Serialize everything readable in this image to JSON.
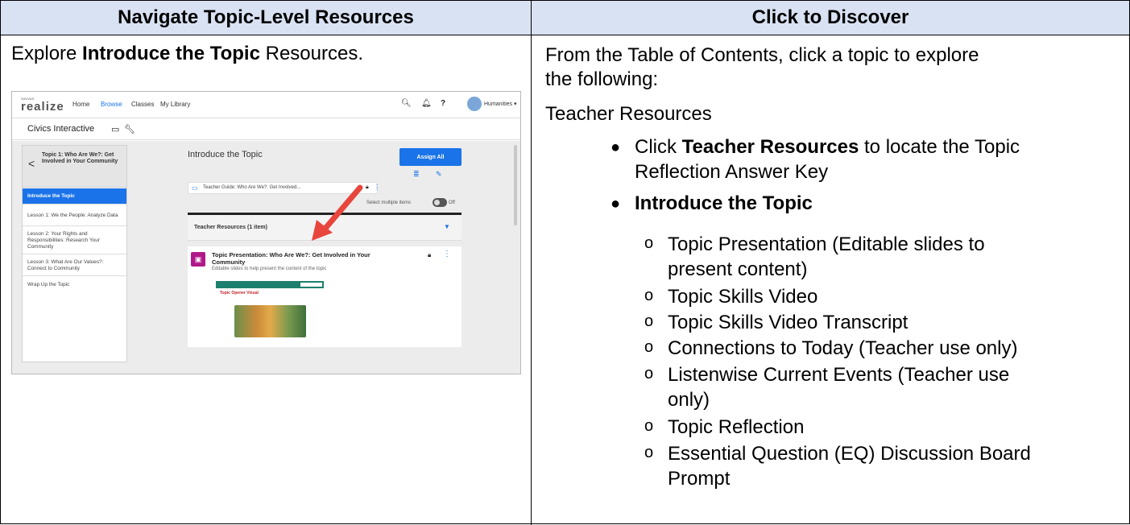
{
  "table": {
    "header_left": "Navigate Topic-Level Resources",
    "header_right": "Click to Discover"
  },
  "left": {
    "intro_prefix": "Explore ",
    "intro_bold": "Introduce the Topic",
    "intro_suffix": " Resources."
  },
  "screenshot": {
    "logo_top": "SAVVAS",
    "logo": "realize",
    "nav": [
      "Home",
      "Browse",
      "Classes",
      "My Library"
    ],
    "user": "Humanities ▾",
    "course_title": "Civics Interactive",
    "sidebar_header": "Topic 1: Who Are We?: Get Involved in Your Community",
    "sidebar_items": [
      "Introduce the Topic",
      "Lesson 1: We the People: Analyze Data",
      "Lesson 2: Your Rights and Responsibilities: Research Your Community",
      "Lesson 3: What Are Our Values?: Connect to Community",
      "Wrap Up the Topic"
    ],
    "panel_heading": "Introduce the Topic",
    "assign_all": "Assign All",
    "guide_label": "Teacher Guide: Who Are We?: Get Involved...",
    "select_multiple": "Select multiple items",
    "toggle_state": "Off",
    "resources_label": "Teacher Resources (1 item)",
    "card_title": "Topic Presentation: Who Are We?: Get Involved in Your Community",
    "card_desc": "Editable slides to help present the content of the topic",
    "thumb_title": "Topic Opener Visual",
    "accent": "#1a73e8",
    "arrow_color": "#e8453c"
  },
  "right": {
    "line1": "From the Table of Contents, click a topic to explore",
    "line2": "the following:",
    "teacher_resources_heading": "Teacher Resources",
    "bullet1_prefix": "Click ",
    "bullet1_bold": "Teacher Resources",
    "bullet1_suffix": " to locate the Topic",
    "bullet1_line2": "Reflection Answer Key",
    "bullet2_bold": "Introduce the Topic",
    "sub_items": [
      "Topic Presentation (Editable slides to",
      "present content)",
      "Topic Skills Video",
      "Topic Skills Video Transcript",
      "Connections to Today (Teacher use only)",
      "Listenwise Current Events (Teacher use",
      "only)",
      "Topic Reflection",
      "Essential Question (EQ) Discussion Board",
      "Prompt"
    ],
    "sub_marker": "o",
    "bullet_marker": "●"
  }
}
